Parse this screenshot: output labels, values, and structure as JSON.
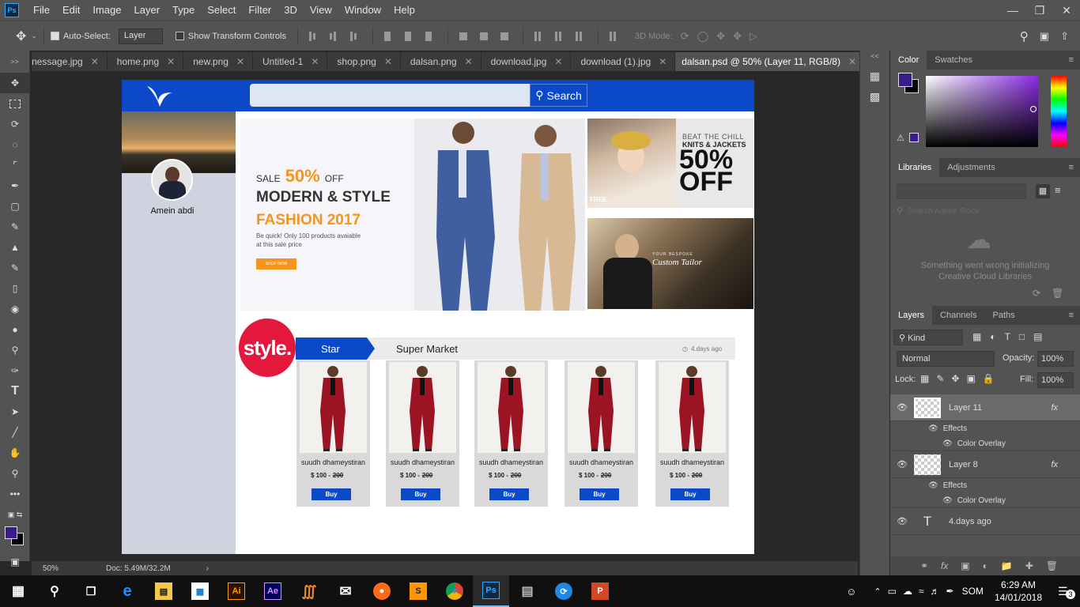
{
  "app": {
    "logo_text": "Ps"
  },
  "menu": [
    "File",
    "Edit",
    "Image",
    "Layer",
    "Type",
    "Select",
    "Filter",
    "3D",
    "View",
    "Window",
    "Help"
  ],
  "options": {
    "auto_select_label": "Auto-Select:",
    "auto_select_value": "Layer",
    "show_transform_label": "Show Transform Controls",
    "mode_3d_label": "3D Mode:"
  },
  "tabs": [
    {
      "label": "nessage.jpg"
    },
    {
      "label": "home.png"
    },
    {
      "label": "new.png"
    },
    {
      "label": "Untitled-1"
    },
    {
      "label": "shop.png"
    },
    {
      "label": "dalsan.png"
    },
    {
      "label": "download.jpg"
    },
    {
      "label": "download (1).jpg"
    },
    {
      "label": "dalsan.psd @ 50% (Layer 11, RGB/8)",
      "active": true
    }
  ],
  "status": {
    "zoom": "50%",
    "doc": "Doc: 5.49M/32.2M"
  },
  "design": {
    "search_button": "Search",
    "profile_name": "Amein abdi",
    "hero": {
      "sale": "SALE",
      "percent": "50%",
      "off": "OFF",
      "headline": "MODERN & STYLE",
      "subhead": "FASHION 2017",
      "desc_line1": "Be quick! Only 100 products avaiable",
      "desc_line2": "at this sale price",
      "cta": "SHOP NOW"
    },
    "promo1": {
      "line1": "BEAT THE CHILL",
      "line2": "KNITS & JACKETS",
      "big": "50%",
      "big2": "OFF",
      "corner": "FREE"
    },
    "promo2": {
      "line1": "YOUR BESPOKE",
      "line2": "Custom Tailor"
    },
    "style_logo": "style.",
    "tab_star": "Star",
    "tab_market": "Super Market",
    "time": "4.days ago",
    "products": [
      {
        "name": "suudh dhameystiran",
        "price": "$ 100 -",
        "old": "200",
        "buy": "Buy"
      },
      {
        "name": "suudh dhameystiran",
        "price": "$ 100 -",
        "old": "200",
        "buy": "Buy"
      },
      {
        "name": "suudh dhameystiran",
        "price": "$ 100 -",
        "old": "200",
        "buy": "Buy"
      },
      {
        "name": "suudh dhameystiran",
        "price": "$ 100 -",
        "old": "200",
        "buy": "Buy"
      },
      {
        "name": "suudh dhameystiran",
        "price": "$ 100 -",
        "old": "200",
        "buy": "Buy"
      }
    ]
  },
  "panels": {
    "color_tabs": [
      "Color",
      "Swatches"
    ],
    "libraries_tabs": [
      "Libraries",
      "Adjustments"
    ],
    "library_search_placeholder": "Search Adobe Stock",
    "library_error_line1": "Something went wrong initializing",
    "library_error_line2": "Creative Cloud Libraries",
    "layers_tabs": [
      "Layers",
      "Channels",
      "Paths"
    ],
    "kind": "Kind",
    "blend": "Normal",
    "opacity_label": "Opacity:",
    "opacity": "100%",
    "lock_label": "Lock:",
    "fill_label": "Fill:",
    "fill": "100%",
    "layers": [
      {
        "name": "Layer 11",
        "effects": "Effects",
        "overlay": "Color Overlay"
      },
      {
        "name": "Layer 8",
        "effects": "Effects",
        "overlay": "Color Overlay"
      },
      {
        "name": "4.days ago"
      }
    ]
  },
  "taskbar": {
    "lang": "SOM",
    "time": "6:29 AM",
    "date": "14/01/2018",
    "notif": "3"
  },
  "colors": {
    "fg": "#3d1a8c",
    "brand_blue": "#0b49c9",
    "orange": "#f7941d",
    "style_red": "#e4173c"
  }
}
